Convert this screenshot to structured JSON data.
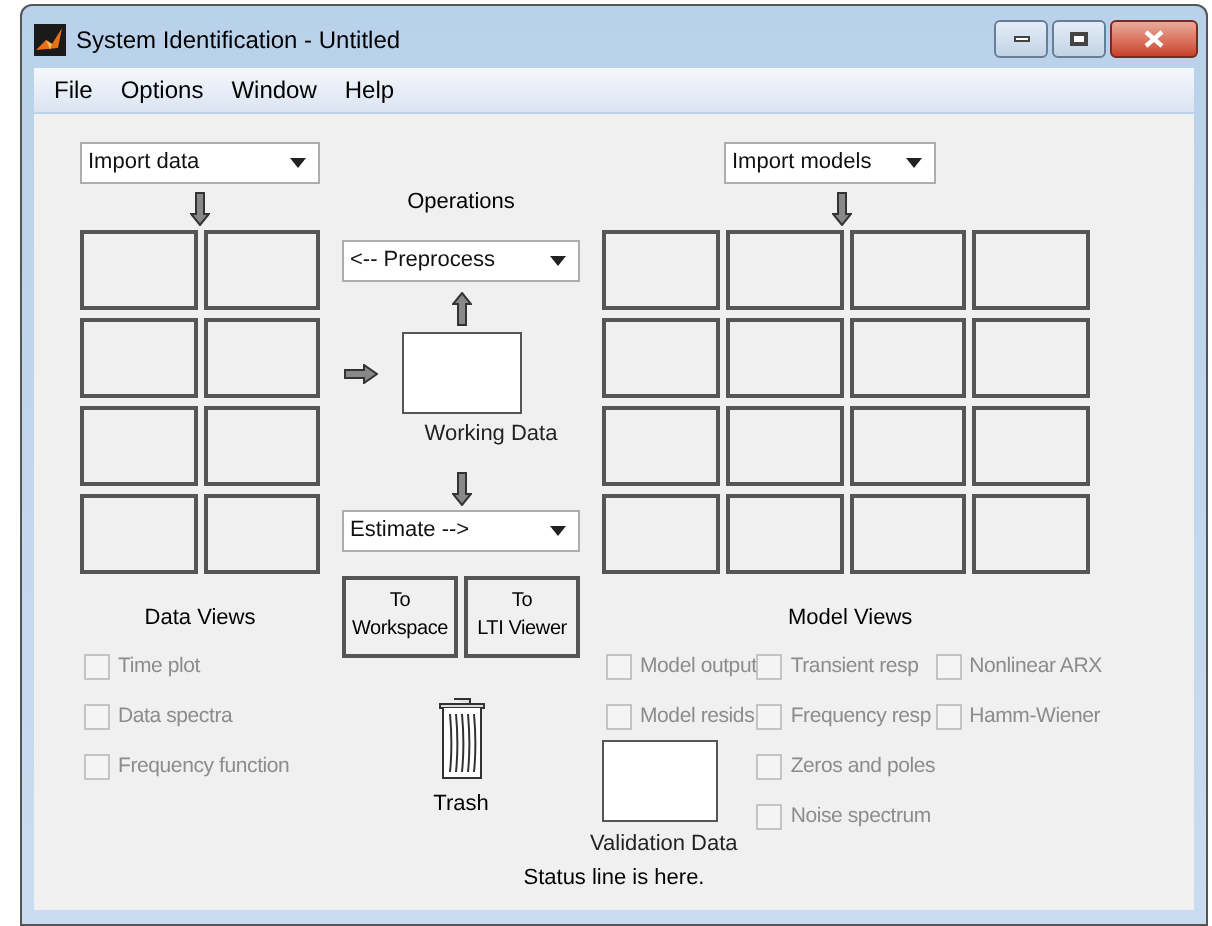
{
  "window": {
    "title": "System Identification - Untitled"
  },
  "menu": [
    "File",
    "Options",
    "Window",
    "Help"
  ],
  "data_board": {
    "dropdown": "Import data"
  },
  "operations": {
    "title": "Operations",
    "preprocess": "<-- Preprocess",
    "working_data": "Working Data",
    "estimate": "Estimate -->"
  },
  "buttons": [
    {
      "lines": [
        "To",
        "Workspace"
      ]
    },
    {
      "lines": [
        "To",
        "LTI Viewer"
      ]
    }
  ],
  "trash": {
    "label": "Trash"
  },
  "data_views": {
    "title": "Data Views",
    "options": [
      {
        "label": "Time plot",
        "checked": false,
        "disabled": true
      },
      {
        "label": "Data spectra",
        "checked": false,
        "disabled": true
      },
      {
        "label": "Frequency function",
        "checked": false,
        "disabled": true
      }
    ]
  },
  "model_board": {
    "dropdown": "Import models"
  },
  "model_views": {
    "title": "Model Views",
    "columns": [
      [
        {
          "label": "Model output",
          "checked": false,
          "disabled": true
        },
        {
          "label": "Model resids",
          "checked": false,
          "disabled": true
        }
      ],
      [
        {
          "label": "Transient resp",
          "checked": false,
          "disabled": true
        },
        {
          "label": "Frequency resp",
          "checked": false,
          "disabled": true
        },
        {
          "label": "Zeros and poles",
          "checked": false,
          "disabled": true
        },
        {
          "label": "Noise spectrum",
          "checked": false,
          "disabled": true
        }
      ],
      [
        {
          "label": "Nonlinear ARX",
          "checked": false,
          "disabled": true
        },
        {
          "label": "Hamm-Wiener",
          "checked": false,
          "disabled": true
        }
      ]
    ]
  },
  "validation": {
    "label": "Validation Data"
  },
  "status_bar": "Status line is here."
}
